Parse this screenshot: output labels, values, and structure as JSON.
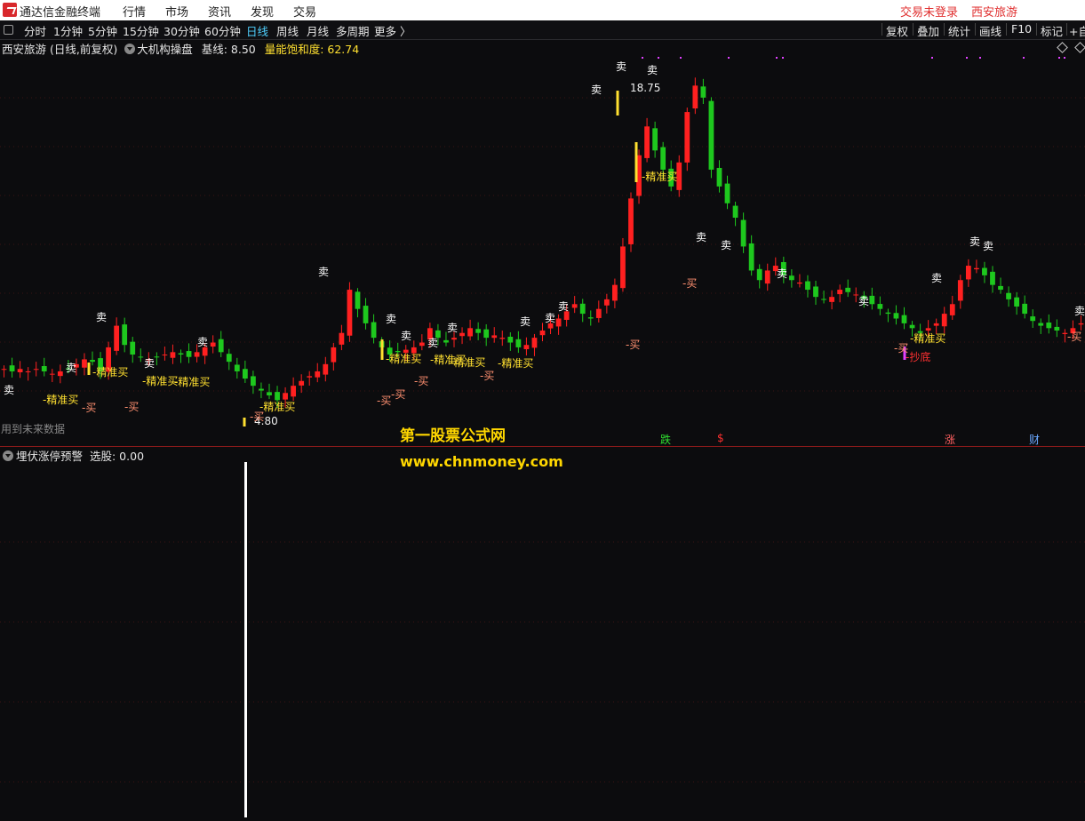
{
  "menubar": {
    "app_title": "通达信金融终端",
    "items": [
      "行情",
      "市场",
      "资讯",
      "发现",
      "交易"
    ],
    "login_status": "交易未登录",
    "stock_name": "西安旅游"
  },
  "toolbar": {
    "periods": [
      "分时",
      "1分钟",
      "5分钟",
      "15分钟",
      "30分钟",
      "60分钟",
      "日线",
      "周线",
      "月线",
      "多周期",
      "更多 〉"
    ],
    "active_period": "日线",
    "right_tools": [
      "复权",
      "叠加",
      "统计",
      "画线",
      "F10",
      "标记",
      "+自"
    ]
  },
  "main_panel": {
    "stock_title": "西安旅游 (日线,前复权)",
    "indicator_name": "大机构操盘",
    "baseline_label": "基线: 8.50",
    "saturation_label": "量能饱和度: 62.74",
    "high_price_label": "18.75",
    "low_price_label": "4.80",
    "future_data_note": "用到未来数据",
    "signal_sell": "卖",
    "signal_precise_buy": "精准买",
    "signal_buy": "买",
    "signal_bottom": "抄底",
    "event_labels": [
      "跌",
      "$",
      "涨",
      "财"
    ]
  },
  "sub_panel": {
    "indicator_name": "埋伏涨停预警",
    "select_label": "选股: 0.00"
  },
  "watermark": {
    "title": "第一股票公式网",
    "url": "www.chnmoney.com"
  },
  "colors": {
    "up": "#ff2020",
    "down": "#1ec81e",
    "signal_yellow": "#ffe030",
    "buy_salmon": "#ff9070",
    "magenta": "#e040ff",
    "header_yellow": "#ffe030"
  },
  "chart_data": {
    "type": "candlestick",
    "title": "西安旅游 (日线,前复权)",
    "price_range_visible": [
      4.8,
      18.75
    ],
    "annotated_high": 18.75,
    "annotated_low": 4.8,
    "indicators": [
      {
        "name": "大机构操盘",
        "values": {
          "基线": 8.5,
          "量能饱和度": 62.74
        }
      },
      {
        "name": "埋伏涨停预警",
        "values": {
          "选股": 0.0
        }
      }
    ],
    "candles_close_approx": [
      6.9,
      6.8,
      6.9,
      6.8,
      6.9,
      6.8,
      6.7,
      6.8,
      6.9,
      7.1,
      7.3,
      7.2,
      6.8,
      7.8,
      8.7,
      7.9,
      7.5,
      7.4,
      7.3,
      7.4,
      7.5,
      7.6,
      7.5,
      7.4,
      7.6,
      7.8,
      8.0,
      7.6,
      7.2,
      6.8,
      6.5,
      6.2,
      6.0,
      5.8,
      5.6,
      5.9,
      6.2,
      6.4,
      6.6,
      6.8,
      7.1,
      7.8,
      8.4,
      10.2,
      9.4,
      8.8,
      8.2,
      7.8,
      7.5,
      7.6,
      7.7,
      7.8,
      8.0,
      8.6,
      8.2,
      8.0,
      8.2,
      8.4,
      8.6,
      8.4,
      8.2,
      8.3,
      8.2,
      8.0,
      7.8,
      7.9,
      8.2,
      8.5,
      8.8,
      9.0,
      9.3,
      9.6,
      9.2,
      9.0,
      9.4,
      9.8,
      10.4,
      12.0,
      14.0,
      15.8,
      17.0,
      16.0,
      15.2,
      14.5,
      15.5,
      17.6,
      18.7,
      18.2,
      15.2,
      14.5,
      13.8,
      13.2,
      12.0,
      11.0,
      10.6,
      11.0,
      11.2,
      10.8,
      10.6,
      10.5,
      10.2,
      9.9,
      9.8,
      9.9,
      10.2,
      10.1,
      10.0,
      9.8,
      9.6,
      9.4,
      9.2,
      9.0,
      8.8,
      8.6,
      8.4,
      8.6,
      8.8,
      9.2,
      9.6,
      10.6,
      11.2,
      11.1,
      10.8,
      10.4,
      10.2,
      9.8,
      9.5,
      9.2,
      8.9,
      8.7,
      8.6,
      8.5,
      8.4,
      8.6,
      8.8
    ]
  }
}
